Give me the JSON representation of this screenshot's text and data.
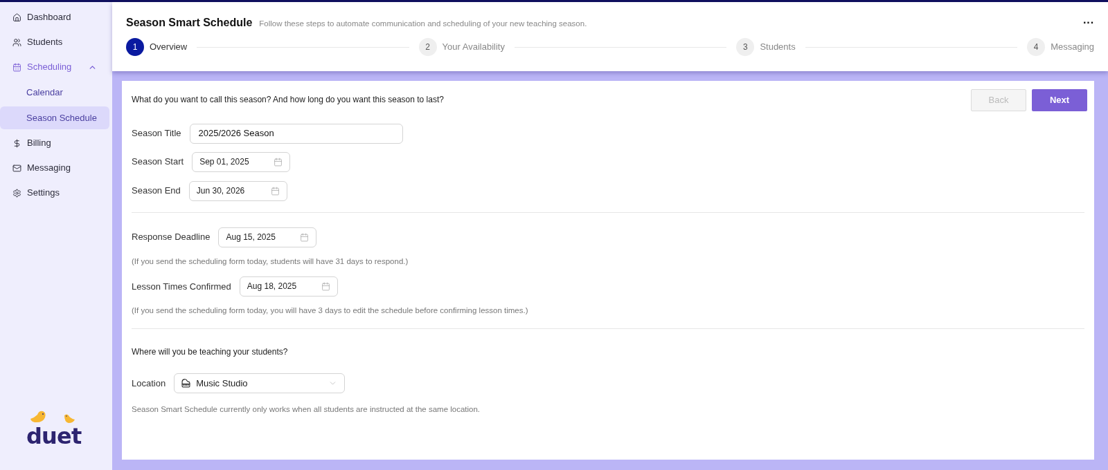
{
  "sidebar": {
    "items": [
      {
        "label": "Dashboard",
        "selected": false
      },
      {
        "label": "Students",
        "selected": false
      },
      {
        "label": "Scheduling",
        "selected": false,
        "expanded": true,
        "children": [
          {
            "label": "Calendar",
            "selected": false
          },
          {
            "label": "Season Schedule",
            "selected": true
          }
        ]
      },
      {
        "label": "Billing",
        "selected": false
      },
      {
        "label": "Messaging",
        "selected": false
      },
      {
        "label": "Settings",
        "selected": false
      }
    ],
    "logo": "duet"
  },
  "header": {
    "title": "Season Smart Schedule",
    "subtitle": "Follow these steps to automate communication and scheduling of your new teaching season.",
    "menu": "···",
    "steps": [
      {
        "number": "1",
        "label": "Overview",
        "selected": true
      },
      {
        "number": "2",
        "label": "Your Availability",
        "selected": false
      },
      {
        "number": "3",
        "label": "Students",
        "selected": false
      },
      {
        "number": "4",
        "label": "Messaging",
        "selected": false
      }
    ]
  },
  "buttons": [
    {
      "label": "Back",
      "disabled": true
    },
    {
      "label": "Next",
      "disabled": false
    }
  ],
  "form": {
    "sections": [
      {
        "items": [
          {
            "kind": "prompt",
            "text": "What do you want to call this season? And how long do you want this season to last?"
          },
          {
            "kind": "text",
            "label": "Season Title",
            "value": "2025/2026 Season"
          },
          {
            "kind": "date",
            "label": "Season Start",
            "value": "Sep 01, 2025"
          },
          {
            "kind": "date",
            "label": "Season End",
            "value": "Jun 30, 2026"
          }
        ]
      },
      {
        "items": [
          {
            "kind": "date",
            "label": "Response Deadline",
            "value": "Aug 15, 2025"
          },
          {
            "kind": "note",
            "text": "(If you send the scheduling form today, students will have 31 days to respond.)"
          },
          {
            "kind": "date",
            "label": "Lesson Times Confirmed",
            "value": "Aug 18, 2025"
          },
          {
            "kind": "note",
            "text": "(If you send the scheduling form today, you will have 3 days to edit the schedule before confirming lesson times.)"
          }
        ]
      },
      {
        "items": [
          {
            "kind": "prompt",
            "text": "Where will you be teaching your students?"
          },
          {
            "kind": "select",
            "label": "Location",
            "value": "Music Studio"
          },
          {
            "kind": "note",
            "text": "Season Smart Schedule currently only works when all students are instructed at the same location."
          }
        ]
      }
    ]
  }
}
